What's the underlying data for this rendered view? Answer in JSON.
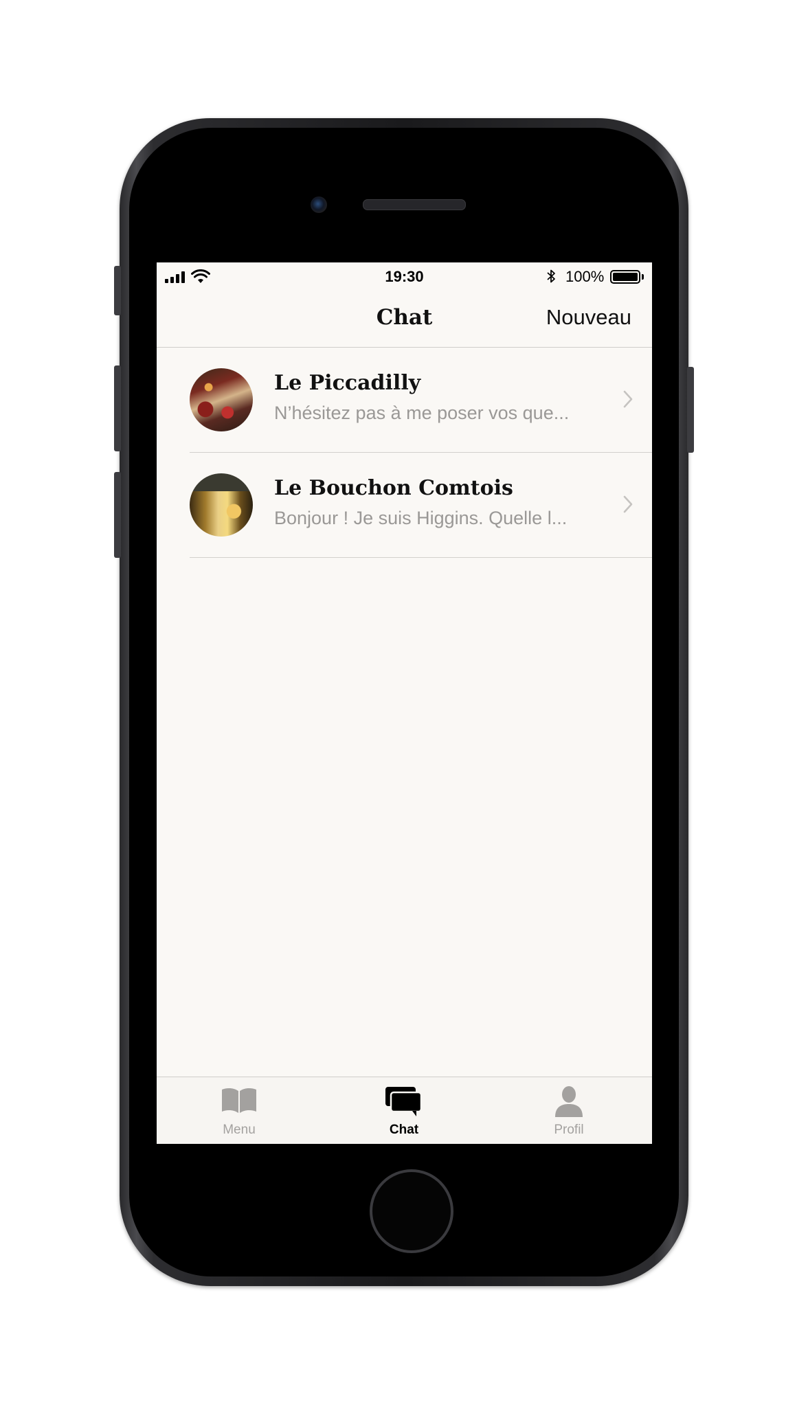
{
  "status_bar": {
    "time": "19:30",
    "battery_percent": "100%",
    "battery_level": 1.0,
    "icons": [
      "signal-icon",
      "wifi-icon",
      "bluetooth-icon",
      "battery-icon"
    ]
  },
  "nav": {
    "title": "Chat",
    "action_label": "Nouveau"
  },
  "chats": [
    {
      "name": "Le Piccadilly",
      "preview": "N’hésitez pas à me poser vos que..."
    },
    {
      "name": "Le Bouchon Comtois",
      "preview": "Bonjour ! Je suis Higgins. Quelle l..."
    }
  ],
  "tabs": [
    {
      "label": "Menu",
      "icon": "book-icon",
      "active": false
    },
    {
      "label": "Chat",
      "icon": "chat-bubbles-icon",
      "active": true
    },
    {
      "label": "Profil",
      "icon": "person-icon",
      "active": false
    }
  ],
  "colors": {
    "screen_background": "#faf8f5",
    "preview_text": "#9a9896",
    "inactive_tab": "#a3a19f",
    "active_tab": "#000000"
  }
}
